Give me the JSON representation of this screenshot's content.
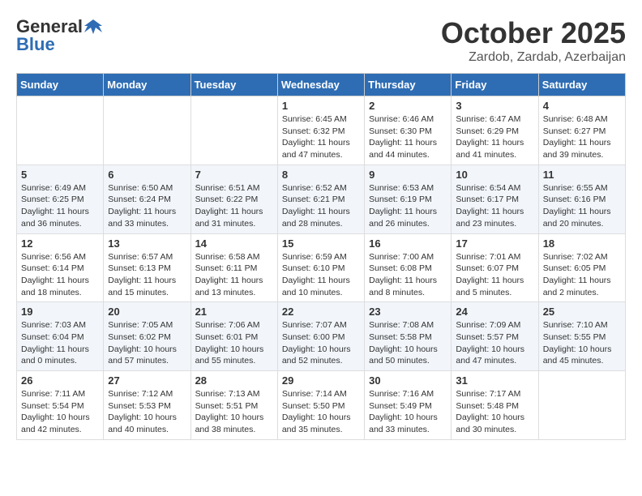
{
  "header": {
    "logo_general": "General",
    "logo_blue": "Blue",
    "month": "October 2025",
    "location": "Zardob, Zardab, Azerbaijan"
  },
  "weekdays": [
    "Sunday",
    "Monday",
    "Tuesday",
    "Wednesday",
    "Thursday",
    "Friday",
    "Saturday"
  ],
  "weeks": [
    [
      {
        "day": "",
        "info": ""
      },
      {
        "day": "",
        "info": ""
      },
      {
        "day": "",
        "info": ""
      },
      {
        "day": "1",
        "info": "Sunrise: 6:45 AM\nSunset: 6:32 PM\nDaylight: 11 hours and 47 minutes."
      },
      {
        "day": "2",
        "info": "Sunrise: 6:46 AM\nSunset: 6:30 PM\nDaylight: 11 hours and 44 minutes."
      },
      {
        "day": "3",
        "info": "Sunrise: 6:47 AM\nSunset: 6:29 PM\nDaylight: 11 hours and 41 minutes."
      },
      {
        "day": "4",
        "info": "Sunrise: 6:48 AM\nSunset: 6:27 PM\nDaylight: 11 hours and 39 minutes."
      }
    ],
    [
      {
        "day": "5",
        "info": "Sunrise: 6:49 AM\nSunset: 6:25 PM\nDaylight: 11 hours and 36 minutes."
      },
      {
        "day": "6",
        "info": "Sunrise: 6:50 AM\nSunset: 6:24 PM\nDaylight: 11 hours and 33 minutes."
      },
      {
        "day": "7",
        "info": "Sunrise: 6:51 AM\nSunset: 6:22 PM\nDaylight: 11 hours and 31 minutes."
      },
      {
        "day": "8",
        "info": "Sunrise: 6:52 AM\nSunset: 6:21 PM\nDaylight: 11 hours and 28 minutes."
      },
      {
        "day": "9",
        "info": "Sunrise: 6:53 AM\nSunset: 6:19 PM\nDaylight: 11 hours and 26 minutes."
      },
      {
        "day": "10",
        "info": "Sunrise: 6:54 AM\nSunset: 6:17 PM\nDaylight: 11 hours and 23 minutes."
      },
      {
        "day": "11",
        "info": "Sunrise: 6:55 AM\nSunset: 6:16 PM\nDaylight: 11 hours and 20 minutes."
      }
    ],
    [
      {
        "day": "12",
        "info": "Sunrise: 6:56 AM\nSunset: 6:14 PM\nDaylight: 11 hours and 18 minutes."
      },
      {
        "day": "13",
        "info": "Sunrise: 6:57 AM\nSunset: 6:13 PM\nDaylight: 11 hours and 15 minutes."
      },
      {
        "day": "14",
        "info": "Sunrise: 6:58 AM\nSunset: 6:11 PM\nDaylight: 11 hours and 13 minutes."
      },
      {
        "day": "15",
        "info": "Sunrise: 6:59 AM\nSunset: 6:10 PM\nDaylight: 11 hours and 10 minutes."
      },
      {
        "day": "16",
        "info": "Sunrise: 7:00 AM\nSunset: 6:08 PM\nDaylight: 11 hours and 8 minutes."
      },
      {
        "day": "17",
        "info": "Sunrise: 7:01 AM\nSunset: 6:07 PM\nDaylight: 11 hours and 5 minutes."
      },
      {
        "day": "18",
        "info": "Sunrise: 7:02 AM\nSunset: 6:05 PM\nDaylight: 11 hours and 2 minutes."
      }
    ],
    [
      {
        "day": "19",
        "info": "Sunrise: 7:03 AM\nSunset: 6:04 PM\nDaylight: 11 hours and 0 minutes."
      },
      {
        "day": "20",
        "info": "Sunrise: 7:05 AM\nSunset: 6:02 PM\nDaylight: 10 hours and 57 minutes."
      },
      {
        "day": "21",
        "info": "Sunrise: 7:06 AM\nSunset: 6:01 PM\nDaylight: 10 hours and 55 minutes."
      },
      {
        "day": "22",
        "info": "Sunrise: 7:07 AM\nSunset: 6:00 PM\nDaylight: 10 hours and 52 minutes."
      },
      {
        "day": "23",
        "info": "Sunrise: 7:08 AM\nSunset: 5:58 PM\nDaylight: 10 hours and 50 minutes."
      },
      {
        "day": "24",
        "info": "Sunrise: 7:09 AM\nSunset: 5:57 PM\nDaylight: 10 hours and 47 minutes."
      },
      {
        "day": "25",
        "info": "Sunrise: 7:10 AM\nSunset: 5:55 PM\nDaylight: 10 hours and 45 minutes."
      }
    ],
    [
      {
        "day": "26",
        "info": "Sunrise: 7:11 AM\nSunset: 5:54 PM\nDaylight: 10 hours and 42 minutes."
      },
      {
        "day": "27",
        "info": "Sunrise: 7:12 AM\nSunset: 5:53 PM\nDaylight: 10 hours and 40 minutes."
      },
      {
        "day": "28",
        "info": "Sunrise: 7:13 AM\nSunset: 5:51 PM\nDaylight: 10 hours and 38 minutes."
      },
      {
        "day": "29",
        "info": "Sunrise: 7:14 AM\nSunset: 5:50 PM\nDaylight: 10 hours and 35 minutes."
      },
      {
        "day": "30",
        "info": "Sunrise: 7:16 AM\nSunset: 5:49 PM\nDaylight: 10 hours and 33 minutes."
      },
      {
        "day": "31",
        "info": "Sunrise: 7:17 AM\nSunset: 5:48 PM\nDaylight: 10 hours and 30 minutes."
      },
      {
        "day": "",
        "info": ""
      }
    ]
  ]
}
